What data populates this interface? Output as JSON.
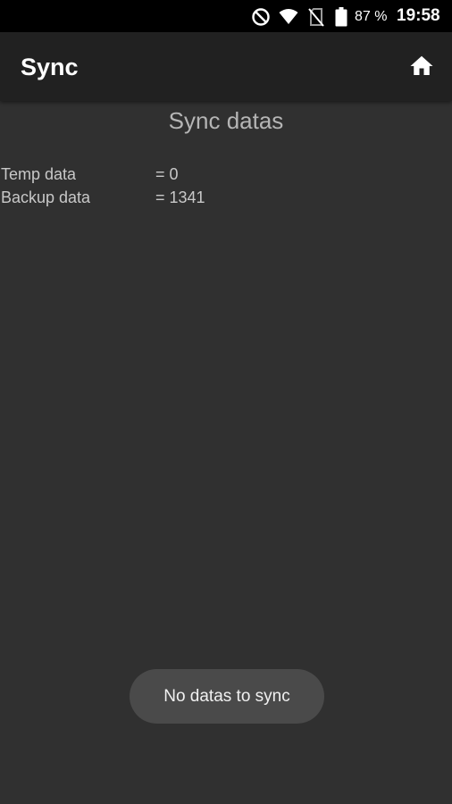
{
  "status_bar": {
    "battery_percent": "87 %",
    "time": "19:58",
    "icons": [
      "do-not-disturb-icon",
      "wifi-icon",
      "no-sim-icon",
      "battery-icon"
    ]
  },
  "app_bar": {
    "title": "Sync",
    "home_icon": "home-icon"
  },
  "content": {
    "title": "Sync datas",
    "rows": [
      {
        "label": "Temp data",
        "value": "= 0"
      },
      {
        "label": "Backup data",
        "value": "= 1341"
      }
    ]
  },
  "toast": {
    "message": "No datas to sync"
  },
  "colors": {
    "background": "#303030",
    "app_bar": "#212121",
    "status_bar": "#000000",
    "toast": "#4a4a4a",
    "text": "#c8c8c8"
  }
}
